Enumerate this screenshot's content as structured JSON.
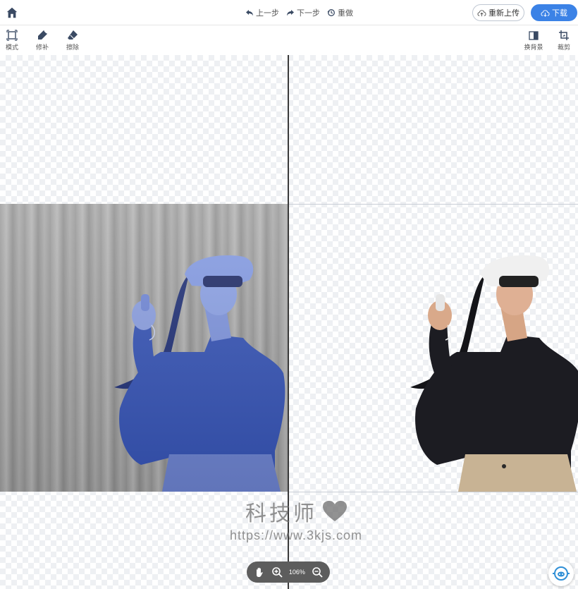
{
  "header": {
    "undo_label": "上一步",
    "redo_label": "下一步",
    "reset_label": "重做",
    "reupload_label": "重新上传",
    "download_label": "下载"
  },
  "toolbar": {
    "mode_label": "模式",
    "repair_label": "修补",
    "erase_label": "擦除",
    "change_bg_label": "换背景",
    "crop_label": "裁剪"
  },
  "zoom": {
    "level": "106%"
  },
  "watermark": {
    "title": "科技师",
    "url": "https://www.3kjs.com"
  },
  "colors": {
    "accent": "#3b82e6",
    "mask_blue": "#3553b5",
    "shirt_black": "#1c1c22",
    "pants_beige": "#c8b394"
  }
}
